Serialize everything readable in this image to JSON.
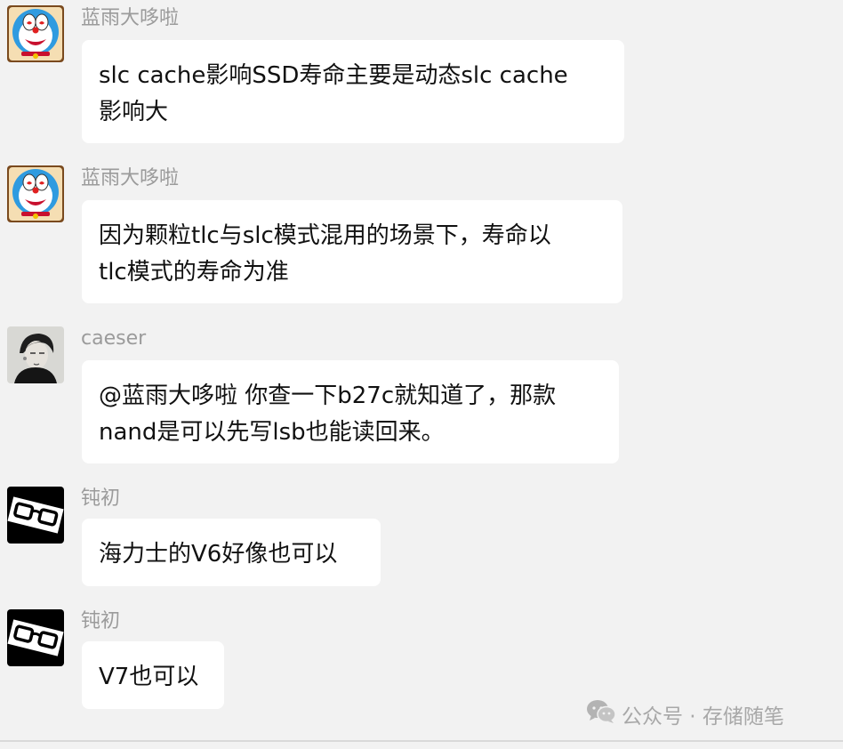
{
  "messages": [
    {
      "sender": "蓝雨大哆啦",
      "avatar": "doraemon-avatar",
      "lines": [
        "slc cache影响SSD寿命主要是动态slc cache",
        "影响大"
      ]
    },
    {
      "sender": "蓝雨大哆啦",
      "avatar": "doraemon-avatar",
      "lines": [
        "因为颗粒tlc与slc模式混用的场景下，寿命以",
        "tlc模式的寿命为准"
      ]
    },
    {
      "sender": "caeser",
      "avatar": "sketch-portrait-avatar",
      "lines": [
        "@蓝雨大哆啦 你查一下b27c就知道了，那款",
        "nand是可以先写lsb也能读回来。"
      ]
    },
    {
      "sender": "钝初",
      "avatar": "glasses-avatar",
      "lines": [
        "海力士的V6好像也可以"
      ]
    },
    {
      "sender": "钝初",
      "avatar": "glasses-avatar",
      "lines": [
        "V7也可以"
      ]
    }
  ],
  "watermark": {
    "icon": "wechat-icon",
    "text": "公众号 · 存储随笔"
  },
  "colors": {
    "background": "#f2f2f2",
    "bubble": "#ffffff",
    "sender_name": "#9b9b9b",
    "message_text": "#111111"
  }
}
